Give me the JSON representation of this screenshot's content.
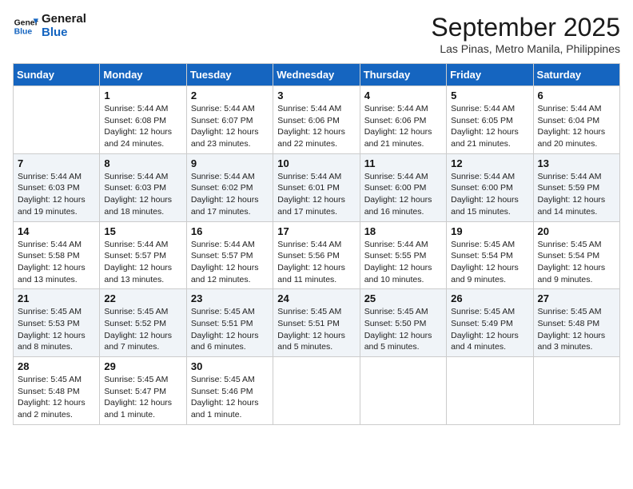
{
  "logo": {
    "line1": "General",
    "line2": "Blue"
  },
  "title": "September 2025",
  "location": "Las Pinas, Metro Manila, Philippines",
  "weekdays": [
    "Sunday",
    "Monday",
    "Tuesday",
    "Wednesday",
    "Thursday",
    "Friday",
    "Saturday"
  ],
  "weeks": [
    [
      {
        "day": "",
        "sunrise": "",
        "sunset": "",
        "daylight": ""
      },
      {
        "day": "1",
        "sunrise": "Sunrise: 5:44 AM",
        "sunset": "Sunset: 6:08 PM",
        "daylight": "Daylight: 12 hours and 24 minutes."
      },
      {
        "day": "2",
        "sunrise": "Sunrise: 5:44 AM",
        "sunset": "Sunset: 6:07 PM",
        "daylight": "Daylight: 12 hours and 23 minutes."
      },
      {
        "day": "3",
        "sunrise": "Sunrise: 5:44 AM",
        "sunset": "Sunset: 6:06 PM",
        "daylight": "Daylight: 12 hours and 22 minutes."
      },
      {
        "day": "4",
        "sunrise": "Sunrise: 5:44 AM",
        "sunset": "Sunset: 6:06 PM",
        "daylight": "Daylight: 12 hours and 21 minutes."
      },
      {
        "day": "5",
        "sunrise": "Sunrise: 5:44 AM",
        "sunset": "Sunset: 6:05 PM",
        "daylight": "Daylight: 12 hours and 21 minutes."
      },
      {
        "day": "6",
        "sunrise": "Sunrise: 5:44 AM",
        "sunset": "Sunset: 6:04 PM",
        "daylight": "Daylight: 12 hours and 20 minutes."
      }
    ],
    [
      {
        "day": "7",
        "sunrise": "Sunrise: 5:44 AM",
        "sunset": "Sunset: 6:03 PM",
        "daylight": "Daylight: 12 hours and 19 minutes."
      },
      {
        "day": "8",
        "sunrise": "Sunrise: 5:44 AM",
        "sunset": "Sunset: 6:03 PM",
        "daylight": "Daylight: 12 hours and 18 minutes."
      },
      {
        "day": "9",
        "sunrise": "Sunrise: 5:44 AM",
        "sunset": "Sunset: 6:02 PM",
        "daylight": "Daylight: 12 hours and 17 minutes."
      },
      {
        "day": "10",
        "sunrise": "Sunrise: 5:44 AM",
        "sunset": "Sunset: 6:01 PM",
        "daylight": "Daylight: 12 hours and 17 minutes."
      },
      {
        "day": "11",
        "sunrise": "Sunrise: 5:44 AM",
        "sunset": "Sunset: 6:00 PM",
        "daylight": "Daylight: 12 hours and 16 minutes."
      },
      {
        "day": "12",
        "sunrise": "Sunrise: 5:44 AM",
        "sunset": "Sunset: 6:00 PM",
        "daylight": "Daylight: 12 hours and 15 minutes."
      },
      {
        "day": "13",
        "sunrise": "Sunrise: 5:44 AM",
        "sunset": "Sunset: 5:59 PM",
        "daylight": "Daylight: 12 hours and 14 minutes."
      }
    ],
    [
      {
        "day": "14",
        "sunrise": "Sunrise: 5:44 AM",
        "sunset": "Sunset: 5:58 PM",
        "daylight": "Daylight: 12 hours and 13 minutes."
      },
      {
        "day": "15",
        "sunrise": "Sunrise: 5:44 AM",
        "sunset": "Sunset: 5:57 PM",
        "daylight": "Daylight: 12 hours and 13 minutes."
      },
      {
        "day": "16",
        "sunrise": "Sunrise: 5:44 AM",
        "sunset": "Sunset: 5:57 PM",
        "daylight": "Daylight: 12 hours and 12 minutes."
      },
      {
        "day": "17",
        "sunrise": "Sunrise: 5:44 AM",
        "sunset": "Sunset: 5:56 PM",
        "daylight": "Daylight: 12 hours and 11 minutes."
      },
      {
        "day": "18",
        "sunrise": "Sunrise: 5:44 AM",
        "sunset": "Sunset: 5:55 PM",
        "daylight": "Daylight: 12 hours and 10 minutes."
      },
      {
        "day": "19",
        "sunrise": "Sunrise: 5:45 AM",
        "sunset": "Sunset: 5:54 PM",
        "daylight": "Daylight: 12 hours and 9 minutes."
      },
      {
        "day": "20",
        "sunrise": "Sunrise: 5:45 AM",
        "sunset": "Sunset: 5:54 PM",
        "daylight": "Daylight: 12 hours and 9 minutes."
      }
    ],
    [
      {
        "day": "21",
        "sunrise": "Sunrise: 5:45 AM",
        "sunset": "Sunset: 5:53 PM",
        "daylight": "Daylight: 12 hours and 8 minutes."
      },
      {
        "day": "22",
        "sunrise": "Sunrise: 5:45 AM",
        "sunset": "Sunset: 5:52 PM",
        "daylight": "Daylight: 12 hours and 7 minutes."
      },
      {
        "day": "23",
        "sunrise": "Sunrise: 5:45 AM",
        "sunset": "Sunset: 5:51 PM",
        "daylight": "Daylight: 12 hours and 6 minutes."
      },
      {
        "day": "24",
        "sunrise": "Sunrise: 5:45 AM",
        "sunset": "Sunset: 5:51 PM",
        "daylight": "Daylight: 12 hours and 5 minutes."
      },
      {
        "day": "25",
        "sunrise": "Sunrise: 5:45 AM",
        "sunset": "Sunset: 5:50 PM",
        "daylight": "Daylight: 12 hours and 5 minutes."
      },
      {
        "day": "26",
        "sunrise": "Sunrise: 5:45 AM",
        "sunset": "Sunset: 5:49 PM",
        "daylight": "Daylight: 12 hours and 4 minutes."
      },
      {
        "day": "27",
        "sunrise": "Sunrise: 5:45 AM",
        "sunset": "Sunset: 5:48 PM",
        "daylight": "Daylight: 12 hours and 3 minutes."
      }
    ],
    [
      {
        "day": "28",
        "sunrise": "Sunrise: 5:45 AM",
        "sunset": "Sunset: 5:48 PM",
        "daylight": "Daylight: 12 hours and 2 minutes."
      },
      {
        "day": "29",
        "sunrise": "Sunrise: 5:45 AM",
        "sunset": "Sunset: 5:47 PM",
        "daylight": "Daylight: 12 hours and 1 minute."
      },
      {
        "day": "30",
        "sunrise": "Sunrise: 5:45 AM",
        "sunset": "Sunset: 5:46 PM",
        "daylight": "Daylight: 12 hours and 1 minute."
      },
      {
        "day": "",
        "sunrise": "",
        "sunset": "",
        "daylight": ""
      },
      {
        "day": "",
        "sunrise": "",
        "sunset": "",
        "daylight": ""
      },
      {
        "day": "",
        "sunrise": "",
        "sunset": "",
        "daylight": ""
      },
      {
        "day": "",
        "sunrise": "",
        "sunset": "",
        "daylight": ""
      }
    ]
  ]
}
